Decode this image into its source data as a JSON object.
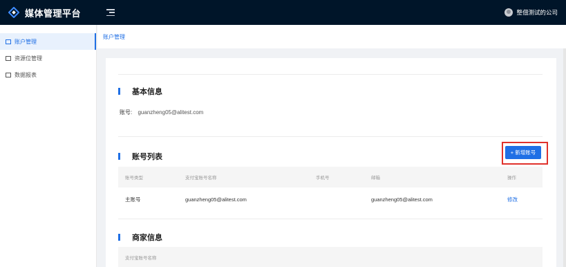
{
  "brand": {
    "title": "媒体管理平台",
    "logo_icon": "diamond-logo-icon"
  },
  "header": {
    "user_name": "整佃测试的公司"
  },
  "sidebar": {
    "items": [
      {
        "label": "账户管理",
        "icon": "account-icon",
        "active": true
      },
      {
        "label": "资源位管理",
        "icon": "grid-icon",
        "active": false
      },
      {
        "label": "数据报表",
        "icon": "report-icon",
        "active": false
      }
    ]
  },
  "breadcrumb": {
    "current": "账户管理"
  },
  "basic_info": {
    "title": "基本信息",
    "account_label": "账号:",
    "account_value": "guanzheng05@alitest.com"
  },
  "account_list": {
    "title": "账号列表",
    "add_button": "+ 新增账号",
    "columns": [
      "账号类型",
      "支付宝账号名称",
      "手机号",
      "邮箱",
      "操作"
    ],
    "rows": [
      {
        "type": "主账号",
        "alipay": "guanzheng05@alitest.com",
        "phone": "",
        "email": "guanzheng05@alitest.com",
        "action": "修改"
      }
    ]
  },
  "merchant_info": {
    "title": "商家信息",
    "columns": [
      "支付宝账号名称"
    ]
  },
  "colors": {
    "primary": "#1f6fe5",
    "header_bg": "#001529",
    "highlight": "#e0312b"
  }
}
